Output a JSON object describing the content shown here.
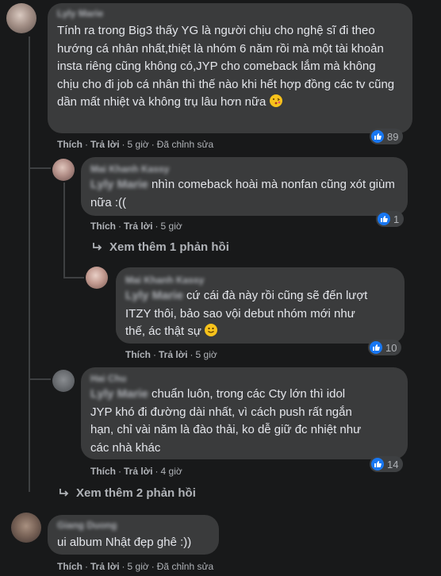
{
  "comments": [
    {
      "author": "Lyly Marie",
      "text": "Tính ra trong Big3 thấy YG là người chịu cho nghệ sĩ đi theo hướng cá nhân nhất,thiệt là nhóm 6 năm rồi mà một tài khoản insta riêng cũng không có,JYP cho comeback lắm mà không chịu cho đi job cá nhân thì thế nào khi hết hợp đồng các tv cũng dần mất nhiệt và không trụ lâu hơn nữa",
      "like": "Thích",
      "reply": "Trả lời",
      "time": "5 giờ",
      "edited": "Đã chỉnh sửa",
      "reactions": "89"
    },
    {
      "author": "Mai Khanh Kassy",
      "mention": "Lyly Marie",
      "text": "nhìn comeback hoài mà nonfan cũng xót giùm nữa :((",
      "like": "Thích",
      "reply": "Trả lời",
      "time": "5 giờ",
      "reactions": "1"
    },
    {
      "more": "Xem thêm 1 phản hồi"
    },
    {
      "author": "Mai Khanh Kassy",
      "mention": "Lyly Marie",
      "text_1": "cứ cái đà này rồi cũng sẽ đến lượt",
      "text_2": "ITZY thôi, bảo sao vội debut nhóm mới như",
      "text_3": "thế, ác thật sự",
      "like": "Thích",
      "reply": "Trả lời",
      "time": "5 giờ",
      "reactions": "10"
    },
    {
      "author": "Hai Chu",
      "mention": "Lyly Marie",
      "text_1": "chuẩn luôn, trong các Cty lớn thì idol",
      "text_2": "JYP khó đi đường dài nhất, vì cách push rất ngắn",
      "text_3": "hạn, chỉ vài năm là đào thải, ko dễ giữ đc nhiệt như",
      "text_4": "các nhà khác",
      "like": "Thích",
      "reply": "Trả lời",
      "time": "4 giờ",
      "reactions": "14"
    },
    {
      "more": "Xem thêm 2 phản hồi"
    },
    {
      "author": "Giang Duong",
      "text": "ui album Nhật đẹp ghê :))",
      "like": "Thích",
      "reply": "Trả lời",
      "time": "5 giờ",
      "edited": "Đã chỉnh sửa"
    }
  ]
}
